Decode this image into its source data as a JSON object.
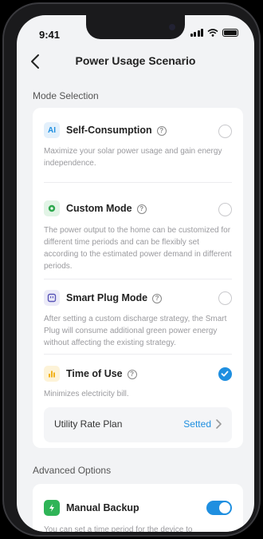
{
  "status": {
    "time": "9:41"
  },
  "header": {
    "title": "Power Usage Scenario"
  },
  "mode_selection": {
    "label": "Mode Selection",
    "options": [
      {
        "title": "Self-Consumption",
        "icon_text": "AI",
        "description": "Maximize your solar power usage and gain energy independence.",
        "selected": false
      },
      {
        "title": "Custom Mode",
        "description": "The power output to the home can be customized for different time periods and can be flexibly set according to the estimated power demand in different periods.",
        "selected": false
      },
      {
        "title": "Smart Plug Mode",
        "description": "After setting a custom discharge strategy, the Smart Plug will consume additional green power energy without affecting the existing strategy.",
        "selected": false
      },
      {
        "title": "Time of Use",
        "description": "Minimizes electricity bill.",
        "selected": true
      }
    ],
    "rate_plan": {
      "label": "Utility Rate Plan",
      "value": "Setted"
    }
  },
  "advanced": {
    "label": "Advanced Options",
    "manual_backup": {
      "title": "Manual Backup",
      "description": "You can set a time period for the device to",
      "enabled": true
    }
  },
  "colors": {
    "accent": "#1f8fe0",
    "background": "#f2f3f5"
  }
}
